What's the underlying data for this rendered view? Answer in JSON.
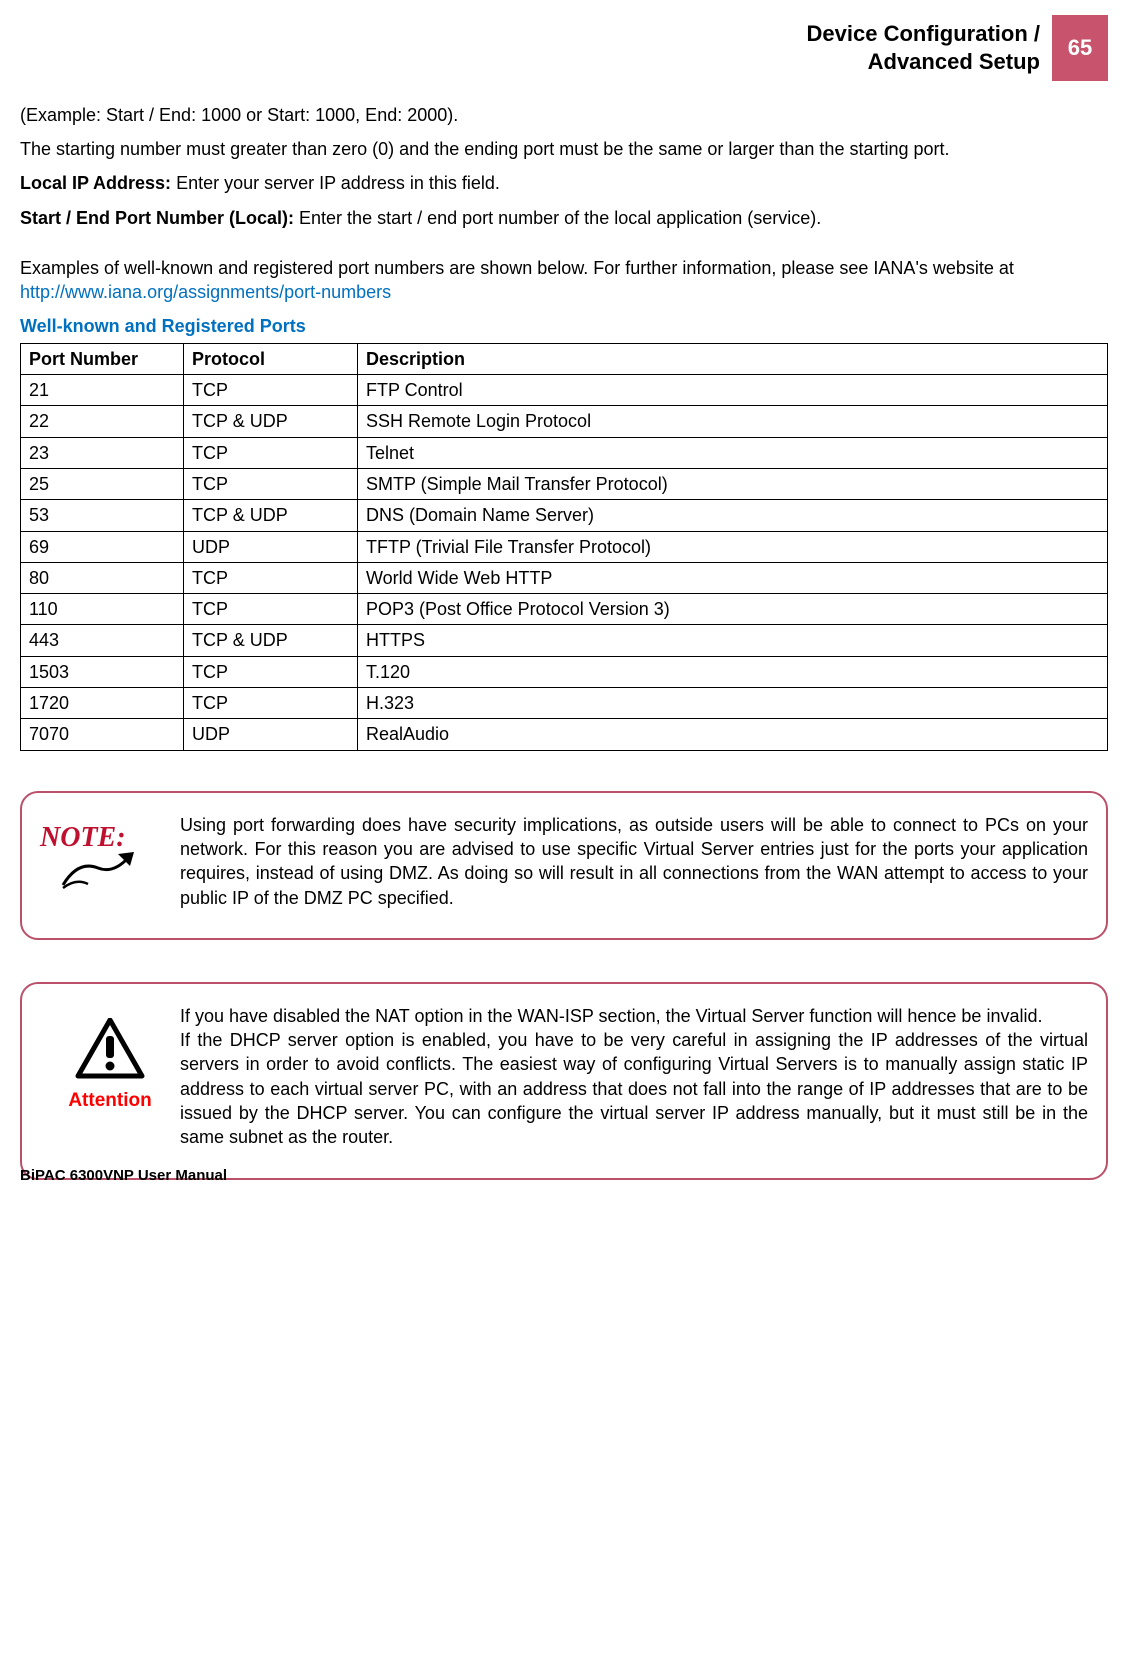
{
  "header": {
    "title_line1": "Device Configuration /",
    "title_line2": "Advanced Setup",
    "page_number": "65"
  },
  "paragraphs": {
    "example": "(Example: Start / End: 1000 or Start: 1000, End: 2000).",
    "starting": "The starting number must greater than zero (0) and the ending port must be the same or larger than the starting port.",
    "local_ip_label": "Local IP Address: ",
    "local_ip_text": "Enter your server IP address in this field.",
    "local_port_label": "Start / End Port Number (Local): ",
    "local_port_text": "Enter the start / end port number of the local application (service).",
    "iana_text_pre": "Examples of well-known and registered port numbers are shown below. For further information, please see IANA's website at ",
    "iana_link": "http://www.iana.org/assignments/port-numbers",
    "section_title": "Well-known and Registered Ports"
  },
  "table": {
    "headers": [
      "Port Number",
      "Protocol",
      "Description"
    ],
    "rows": [
      [
        "21",
        "TCP",
        "FTP Control"
      ],
      [
        "22",
        "TCP & UDP",
        "SSH Remote Login Protocol"
      ],
      [
        "23",
        "TCP",
        "Telnet"
      ],
      [
        "25",
        "TCP",
        "SMTP (Simple Mail Transfer Protocol)"
      ],
      [
        "53",
        "TCP & UDP",
        "DNS (Domain Name Server)"
      ],
      [
        "69",
        "UDP",
        "TFTP (Trivial File Transfer Protocol)"
      ],
      [
        "80",
        "TCP",
        "World Wide Web HTTP"
      ],
      [
        "110",
        "TCP",
        "POP3 (Post Office Protocol Version 3)"
      ],
      [
        "443",
        "TCP & UDP",
        "HTTPS"
      ],
      [
        "1503",
        "TCP",
        "T.120"
      ],
      [
        "1720",
        "TCP",
        "H.323"
      ],
      [
        "7070",
        "UDP",
        "RealAudio"
      ]
    ]
  },
  "note": {
    "label": "NOTE:",
    "text": "Using port forwarding does have security implications, as outside users will be able to connect to PCs on your network. For this reason you are advised to use specific Virtual Server entries just for the ports your application requires, instead of using DMZ. As doing so will result in all connections from the WAN attempt to access to your public IP of the DMZ PC specified."
  },
  "attention": {
    "label": "Attention",
    "text1": "If you have disabled the NAT option in the WAN-ISP section, the Virtual Server function will hence be invalid.",
    "text2": "If the DHCP server option is enabled, you have to be very careful in assigning the IP addresses of the virtual servers in order to avoid conflicts. The easiest way of configuring Virtual Servers is to manually assign static IP address to each virtual server PC, with an address that does not fall into the range of IP addresses that are to be issued by the DHCP server. You can configure the virtual server IP address manually, but it must still be in the same subnet as the router."
  },
  "footer": "BiPAC 6300VNP User Manual"
}
